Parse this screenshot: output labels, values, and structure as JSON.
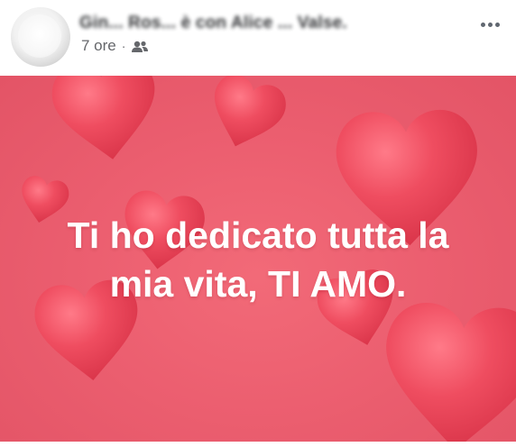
{
  "post": {
    "author_name": "Gin... Ros... è con Alice ... Valse.",
    "timestamp": "7 ore",
    "separator": "·",
    "audience_icon": "friends-icon",
    "more_icon": "more-options-icon"
  },
  "image": {
    "caption_line1": "Ti ho dedicato tutta la",
    "caption_line2": "mia vita, TI AMO.",
    "background_color": "#ec5f70",
    "heart_color": "#ee4b5d"
  }
}
